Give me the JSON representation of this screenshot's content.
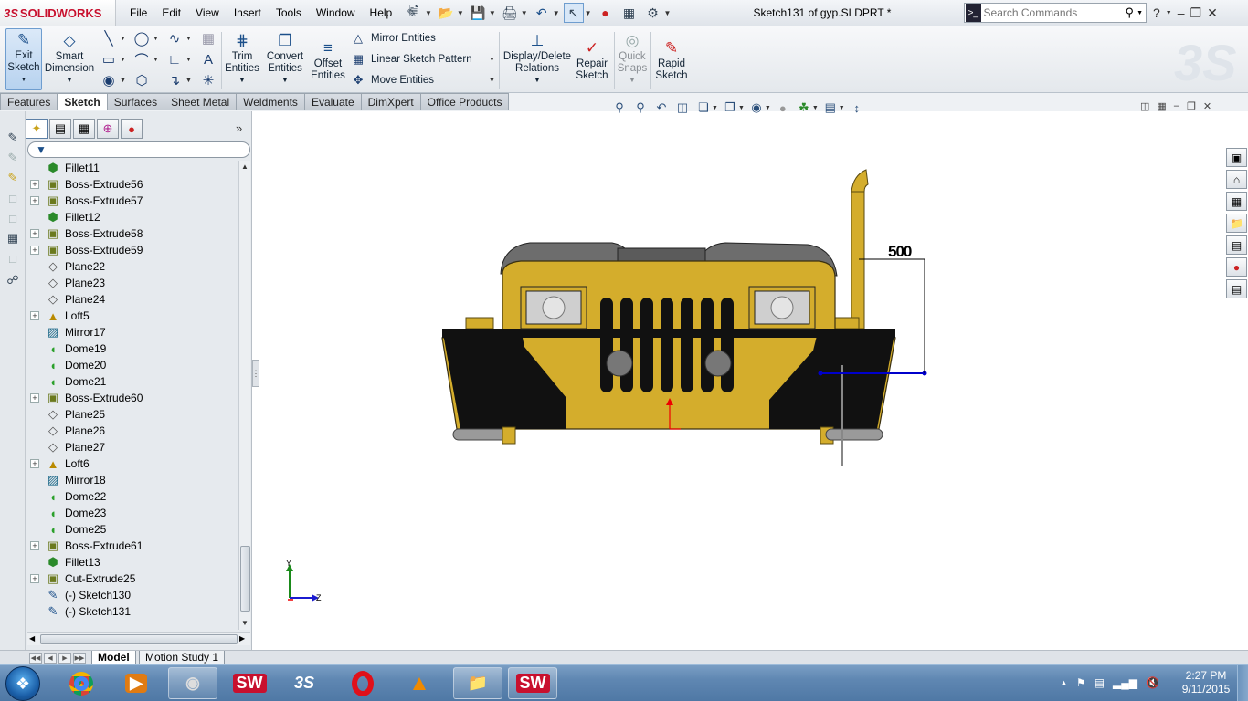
{
  "titlebar": {
    "logo_prefix": "3S",
    "logo_text": "SOLIDWORKS",
    "menus": [
      "File",
      "Edit",
      "View",
      "Insert",
      "Tools",
      "Window",
      "Help"
    ],
    "document_title": "Sketch131 of gyp.SLDPRT *",
    "search_placeholder": "Search Commands"
  },
  "ribbon": {
    "exit_sketch": "Exit\nSketch",
    "smart_dimension": "Smart\nDimension",
    "trim_entities": "Trim\nEntities",
    "convert_entities": "Convert\nEntities",
    "offset_entities": "Offset\nEntities",
    "mirror_entities": "Mirror Entities",
    "linear_sketch_pattern": "Linear Sketch Pattern",
    "move_entities": "Move Entities",
    "display_delete_relations": "Display/Delete\nRelations",
    "repair_sketch": "Repair\nSketch",
    "quick_snaps": "Quick\nSnaps",
    "rapid_sketch": "Rapid\nSketch"
  },
  "tabs": [
    "Features",
    "Sketch",
    "Surfaces",
    "Sheet Metal",
    "Weldments",
    "Evaluate",
    "DimXpert",
    "Office Products"
  ],
  "active_tab": "Sketch",
  "tree": [
    {
      "label": "Fillet11",
      "icon": "fillet",
      "exp": false
    },
    {
      "label": "Boss-Extrude56",
      "icon": "extr",
      "exp": true
    },
    {
      "label": "Boss-Extrude57",
      "icon": "extr",
      "exp": true
    },
    {
      "label": "Fillet12",
      "icon": "fillet",
      "exp": false
    },
    {
      "label": "Boss-Extrude58",
      "icon": "extr",
      "exp": true
    },
    {
      "label": "Boss-Extrude59",
      "icon": "extr",
      "exp": true
    },
    {
      "label": "Plane22",
      "icon": "plane",
      "exp": false
    },
    {
      "label": "Plane23",
      "icon": "plane",
      "exp": false
    },
    {
      "label": "Plane24",
      "icon": "plane",
      "exp": false
    },
    {
      "label": "Loft5",
      "icon": "loft",
      "exp": true
    },
    {
      "label": "Mirror17",
      "icon": "mirror",
      "exp": false
    },
    {
      "label": "Dome19",
      "icon": "dome",
      "exp": false
    },
    {
      "label": "Dome20",
      "icon": "dome",
      "exp": false
    },
    {
      "label": "Dome21",
      "icon": "dome",
      "exp": false
    },
    {
      "label": "Boss-Extrude60",
      "icon": "extr",
      "exp": true
    },
    {
      "label": "Plane25",
      "icon": "plane",
      "exp": false
    },
    {
      "label": "Plane26",
      "icon": "plane",
      "exp": false
    },
    {
      "label": "Plane27",
      "icon": "plane",
      "exp": false
    },
    {
      "label": "Loft6",
      "icon": "loft",
      "exp": true
    },
    {
      "label": "Mirror18",
      "icon": "mirror",
      "exp": false
    },
    {
      "label": "Dome22",
      "icon": "dome",
      "exp": false
    },
    {
      "label": "Dome23",
      "icon": "dome",
      "exp": false
    },
    {
      "label": "Dome25",
      "icon": "dome",
      "exp": false
    },
    {
      "label": "Boss-Extrude61",
      "icon": "extr",
      "exp": true
    },
    {
      "label": "Fillet13",
      "icon": "fillet",
      "exp": false
    },
    {
      "label": "Cut-Extrude25",
      "icon": "extr",
      "exp": true
    },
    {
      "label": "(-) Sketch130",
      "icon": "sketch",
      "exp": false
    },
    {
      "label": "(-) Sketch131",
      "icon": "sketch",
      "exp": false
    }
  ],
  "viewport": {
    "dimension_value": "500",
    "axis_y": "Y",
    "axis_z": "Z"
  },
  "bottom_tabs": {
    "model": "Model",
    "motion_study": "Motion Study 1"
  },
  "taskbar": {
    "time": "2:27 PM",
    "date": "9/11/2015"
  },
  "colors": {
    "body_yellow": "#d4ad2c",
    "accent_blue": "#1b4f8a",
    "sketch_blue": "#0000cc"
  }
}
